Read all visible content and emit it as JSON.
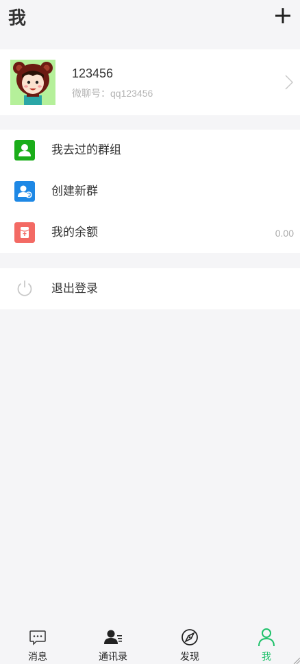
{
  "header": {
    "title": "我",
    "add_icon": "plus-icon"
  },
  "profile": {
    "nickname": "123456",
    "wechat_id_label": "微聊号：",
    "wechat_id": "qq123456",
    "avatar_icon": "bear-costume-avatar",
    "chevron_icon": "chevron-right-icon"
  },
  "menu": {
    "items": [
      {
        "label": "我去过的群组",
        "icon": "person-icon",
        "color": "#1aad19",
        "value": ""
      },
      {
        "label": "创建新群",
        "icon": "add-group-icon",
        "color": "#1e88e5",
        "value": ""
      },
      {
        "label": "我的余额",
        "icon": "red-packet-icon",
        "color": "#f36a64",
        "value": "0.00"
      }
    ]
  },
  "logout": {
    "label": "退出登录",
    "icon": "power-icon"
  },
  "tabbar": {
    "tabs": [
      {
        "label": "消息",
        "icon": "chat-bubble-icon",
        "active": false
      },
      {
        "label": "通讯录",
        "icon": "contacts-icon",
        "active": false
      },
      {
        "label": "发现",
        "icon": "compass-icon",
        "active": false
      },
      {
        "label": "我",
        "icon": "person-outline-icon",
        "active": true
      }
    ],
    "active_color": "#1ec16a"
  }
}
